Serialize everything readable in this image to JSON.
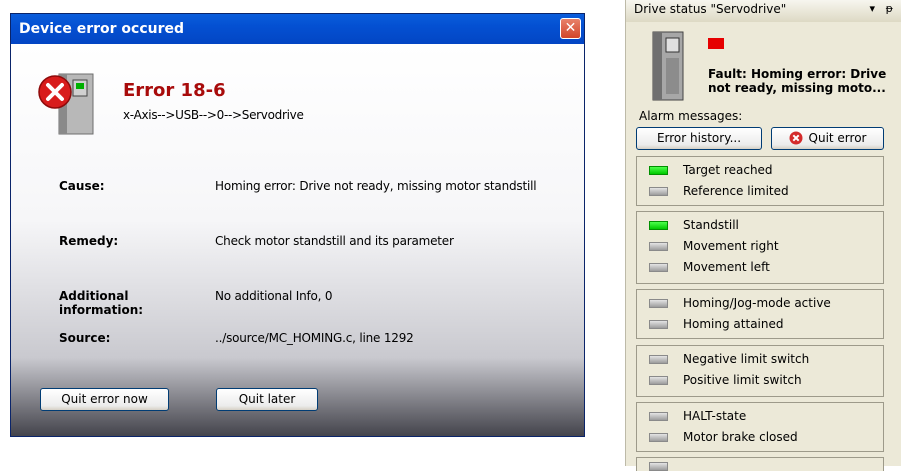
{
  "dialog": {
    "title": "Device error occured",
    "close_symbol": "✕",
    "error_code": "Error 18-6",
    "path": "x-Axis-->USB-->0-->Servodrive",
    "fields": [
      {
        "label": "Cause:",
        "value": "Homing error: Drive not ready, missing motor standstill"
      },
      {
        "label": "Remedy:",
        "value": "Check motor standstill and its parameter"
      },
      {
        "label": "Additional information:",
        "value": "No additional Info, 0"
      },
      {
        "label": "Source:",
        "value": "../source/MC_HOMING.c, line 1292"
      }
    ],
    "quit_now_label": "Quit error now",
    "quit_later_label": "Quit later",
    "icons": {
      "error": "error-x-icon",
      "drive": "servodrive-icon"
    }
  },
  "panel": {
    "title": "Drive status \"Servodrive\"",
    "dropdown_symbol": "▾",
    "pin_symbol": "ᵽ",
    "fault_line1": "Fault: Homing error: Drive",
    "fault_line2": "not ready, missing moto...",
    "alarm_label": "Alarm messages:",
    "error_history_label": "Error history...",
    "quit_error_label": "Quit error",
    "groups": [
      [
        {
          "label": "Target reached",
          "on": true
        },
        {
          "label": "Reference limited",
          "on": false
        }
      ],
      [
        {
          "label": "Standstill",
          "on": true
        },
        {
          "label": "Movement right",
          "on": false
        },
        {
          "label": "Movement left",
          "on": false
        }
      ],
      [
        {
          "label": "Homing/Jog-mode active",
          "on": false
        },
        {
          "label": "Homing attained",
          "on": false
        }
      ],
      [
        {
          "label": "Negative limit switch",
          "on": false
        },
        {
          "label": "Positive limit switch",
          "on": false
        }
      ],
      [
        {
          "label": "HALT-state",
          "on": false
        },
        {
          "label": "Motor brake closed",
          "on": false
        }
      ]
    ],
    "colors": {
      "fault_led": "#e60000",
      "status_on": "#00e000",
      "status_off": "#b4b4b4"
    }
  }
}
